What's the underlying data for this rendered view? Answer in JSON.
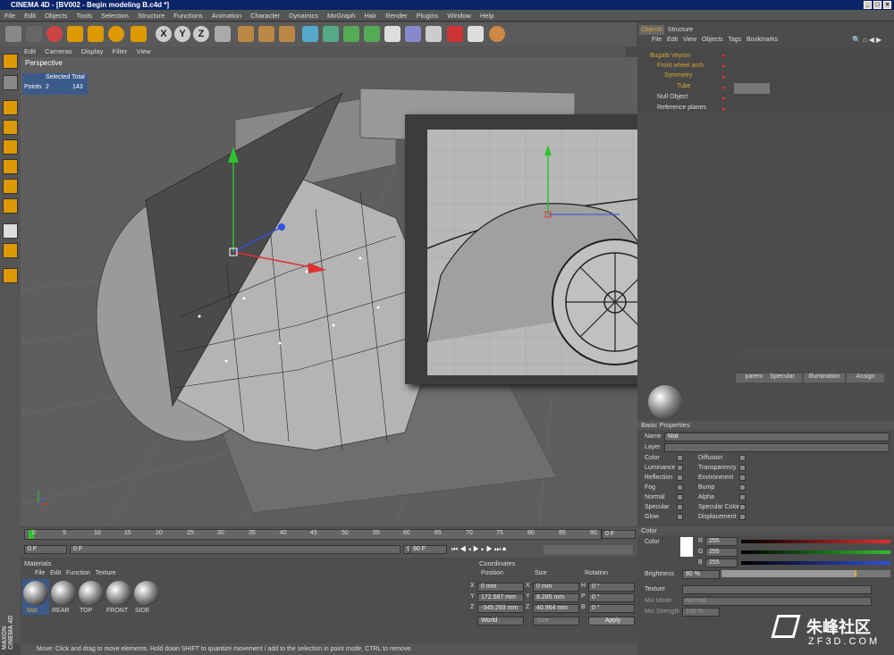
{
  "app": {
    "title": "CINEMA 4D - [BV002 - Begin modeling B.c4d *]"
  },
  "menubar": [
    "File",
    "Edit",
    "Objects",
    "Tools",
    "Selection",
    "Structure",
    "Functions",
    "Animation",
    "Character",
    "Dynamics",
    "MoGraph",
    "Hair",
    "Render",
    "Plugins",
    "Window",
    "Help"
  ],
  "viewport": {
    "menu": [
      "Edit",
      "Cameras",
      "Display",
      "Filter",
      "View"
    ],
    "name": "Perspective",
    "stats_header": "Selected Total",
    "stats_label": "Points",
    "stats_selected": "2",
    "stats_total": "143"
  },
  "toolbar_icons": [
    "undo-icon",
    "redo-icon",
    "live-select-icon",
    "move-icon",
    "scale-icon",
    "rotate-icon",
    "world-axis-icon",
    "x-axis-icon",
    "y-axis-icon",
    "z-axis-icon",
    "render-view-icon",
    "render-picture-viewer-icon",
    "render-settings-icon",
    "cube-icon",
    "spline-icon",
    "nurbs-icon",
    "array-icon",
    "deformer-icon",
    "scene-icon",
    "light-icon",
    "camera-icon",
    "help-icon",
    "layout-icon",
    "globe-icon"
  ],
  "axes_letters": [
    "X",
    "Y",
    "Z"
  ],
  "timeline": {
    "ticks": [
      "0",
      "5",
      "10",
      "15",
      "20",
      "25",
      "30",
      "35",
      "40",
      "45",
      "50",
      "55",
      "60",
      "65",
      "70",
      "75",
      "80",
      "85",
      "90"
    ],
    "current": "0 F",
    "start": "0 F",
    "frame": "0 F",
    "end": "90 F",
    "end2": "90 F"
  },
  "materials": {
    "title": "Materials",
    "menu": [
      "File",
      "Edit",
      "Function",
      "Texture"
    ],
    "items": [
      "Mat",
      "REAR",
      "TOP",
      "FRONT",
      "SIDE"
    ]
  },
  "coords": {
    "title": "Coordinates",
    "headers": [
      "Position",
      "Size",
      "Rotation"
    ],
    "rows": [
      {
        "axis": "X",
        "pos": "0 mm",
        "saxis": "X",
        "size": "0 mm",
        "raxis": "H",
        "rot": "0 °"
      },
      {
        "axis": "Y",
        "pos": "172.587 mm",
        "saxis": "Y",
        "size": "8.285 mm",
        "raxis": "P",
        "rot": "0 °"
      },
      {
        "axis": "Z",
        "pos": "-345.293 mm",
        "saxis": "Z",
        "size": "40.964 mm",
        "raxis": "B",
        "rot": "0 °"
      }
    ],
    "mode": "World",
    "size_mode": "Size",
    "apply": "Apply"
  },
  "status": "Move: Click and drag to move elements. Hold down SHIFT to quantize movement / add to the selection in point mode, CTRL to remove.",
  "objects": {
    "tabs": [
      "Objects",
      "Structure"
    ],
    "menu": [
      "File",
      "Edit",
      "View",
      "Objects",
      "Tags",
      "Bookmarks"
    ],
    "items": [
      "Bugatti Veyron",
      "Front wheel arch",
      "Symmetry",
      "Tube",
      "Null Object",
      "Reference planes"
    ]
  },
  "attributes": {
    "tabs": [
      "parency",
      "Specular",
      "Illumination",
      "Assign"
    ],
    "section": "Basic Properties",
    "name_label": "Name",
    "name_value": "Mat",
    "layer_label": "Layer",
    "channels_left": [
      "Color",
      "Luminance",
      "Reflection",
      "Fog",
      "Normal",
      "Specular",
      "Glow"
    ],
    "channels_right": [
      "Diffusion",
      "Transparency",
      "Environment",
      "Bump",
      "Alpha",
      "Specular Color",
      "Displacement"
    ],
    "color_section": "Color",
    "color_label": "Color",
    "r": "255",
    "g": "255",
    "b": "255",
    "brightness_label": "Brightness",
    "brightness": "80 %",
    "texture_label": "Texture",
    "mixmode_label": "Mix Mode",
    "mixmode": "Normal",
    "mixstrength_label": "Mix Strength",
    "mixstrength": "100 %"
  },
  "watermark": {
    "text": "朱峰社区",
    "url": "ZF3D.COM"
  },
  "vertical_logo": "MAXON CINEMA 4D",
  "colors": {
    "accent": "#d8a838",
    "selection": "#7aa8e0",
    "x": "#e03030",
    "y": "#30c030",
    "z": "#3050e0"
  }
}
